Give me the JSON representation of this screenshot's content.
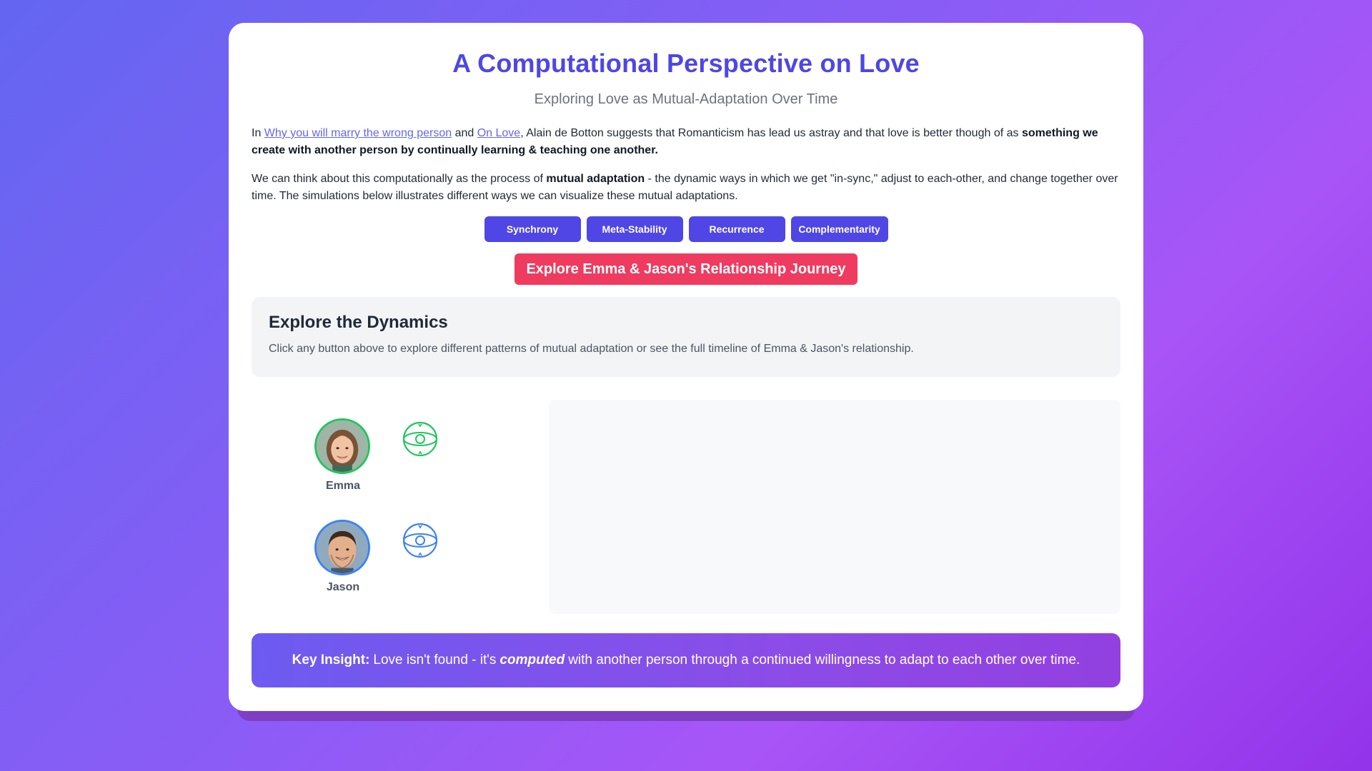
{
  "header": {
    "title": "A Computational Perspective on Love",
    "subtitle": "Exploring Love as Mutual-Adaptation Over Time"
  },
  "intro": {
    "p1_in": "In",
    "link1": "Why you will marry the wrong person",
    "p1_and": "and",
    "link2": "On Love",
    "p1_rest": ", Alain de Botton suggests that Romanticism has lead us astray and that love is better though of as",
    "p1_bold": "something we create with another person by continually learning & teaching one another.",
    "p2_start": "We can think about this computationally as the process of",
    "p2_bold": "mutual adaptation",
    "p2_rest": "- the dynamic ways in which we get \"in-sync,\" adjust to each-other, and change together over time. The simulations below illustrates different ways we can visualize these mutual adaptations."
  },
  "buttons": {
    "synchrony": "Synchrony",
    "meta_stability": "Meta-Stability",
    "recurrence": "Recurrence",
    "complementarity": "Complementarity",
    "journey": "Explore Emma & Jason's Relationship Journey"
  },
  "dynamics": {
    "title": "Explore the Dynamics",
    "text": "Click any button above to explore different patterns of mutual adaptation or see the full timeline of Emma & Jason's relationship."
  },
  "people": {
    "emma": {
      "name": "Emma",
      "color": "#22c55e"
    },
    "jason": {
      "name": "Jason",
      "color": "#3b82f6"
    }
  },
  "insight": {
    "label": "Key Insight:",
    "pre": "Love isn't found - it's",
    "emph": "computed",
    "post": "with another person through a continued willingness to adapt to each other over time."
  },
  "colors": {
    "accent": "#4f46e5",
    "journey": "#ef3b5f",
    "emma": "#22c55e",
    "jason": "#3b82f6"
  },
  "icons": {
    "emma_state": "orbit-ring-icon",
    "jason_state": "orbit-ring-icon"
  }
}
